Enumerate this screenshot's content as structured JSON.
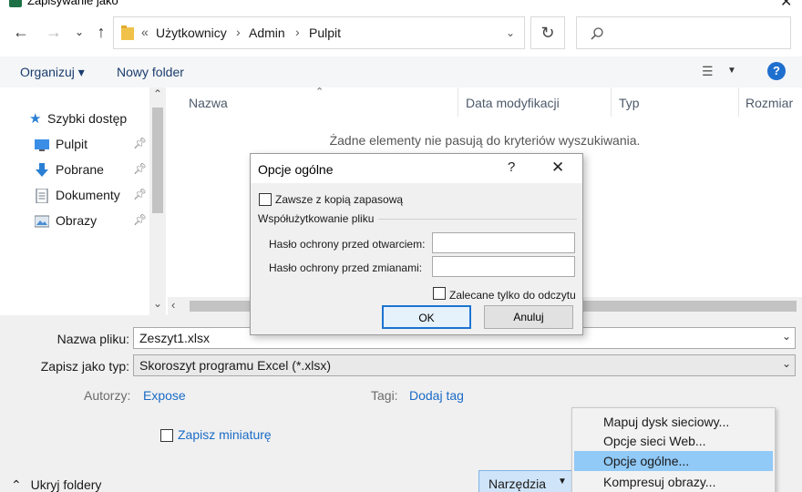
{
  "window": {
    "title": "Zapisywanie jako",
    "close_icon": "close-icon"
  },
  "nav": {
    "breadcrumb": [
      "Użytkownicy",
      "Admin",
      "Pulpit"
    ],
    "breadcrumb_prefix": "«",
    "search_placeholder": ""
  },
  "toolbar": {
    "organize_label": "Organizuj ▾",
    "new_folder_label": "Nowy folder",
    "help_label": "?"
  },
  "sidebar": {
    "items": [
      {
        "label": "Szybki dostęp",
        "icon": "star-icon"
      },
      {
        "label": "Pulpit",
        "icon": "desktop-icon"
      },
      {
        "label": "Pobrane",
        "icon": "download-icon"
      },
      {
        "label": "Dokumenty",
        "icon": "document-icon"
      },
      {
        "label": "Obrazy",
        "icon": "pictures-icon"
      }
    ]
  },
  "filelist": {
    "columns": [
      "Nazwa",
      "Data modyfikacji",
      "Typ",
      "Rozmiar"
    ],
    "empty_message": "Żadne elementy nie pasują do kryteriów wyszukiwania."
  },
  "form": {
    "filename_label": "Nazwa pliku:",
    "filename_value": "Zeszyt1.xlsx",
    "type_label": "Zapisz jako typ:",
    "type_value": "Skoroszyt programu Excel (*.xlsx)",
    "authors_label": "Autorzy:",
    "authors_value": "Expose",
    "tags_label": "Tagi:",
    "tags_value": "Dodaj tag",
    "thumbnail_label": "Zapisz miniaturę"
  },
  "footer": {
    "hide_folders_label": "Ukryj foldery",
    "tools_label": "Narzędzia"
  },
  "tools_menu": {
    "items": [
      "Mapuj dysk sieciowy...",
      "Opcje sieci Web...",
      "Opcje ogólne...",
      "Kompresuj obrazy..."
    ],
    "selected_index": 2
  },
  "modal": {
    "title": "Opcje ogólne",
    "help_label": "?",
    "backup_label": "Zawsze z kopią zapasową",
    "section_label": "Współużytkowanie pliku",
    "open_password_label": "Hasło ochrony przed otwarciem:",
    "modify_password_label": "Hasło ochrony przed zmianami:",
    "readonly_label": "Zalecane tylko do odczytu",
    "ok_label": "OK",
    "cancel_label": "Anuluj"
  },
  "colors": {
    "accent": "#1f6fcf",
    "menu_selected": "#91c9f7",
    "excel_green": "#1e7145"
  }
}
